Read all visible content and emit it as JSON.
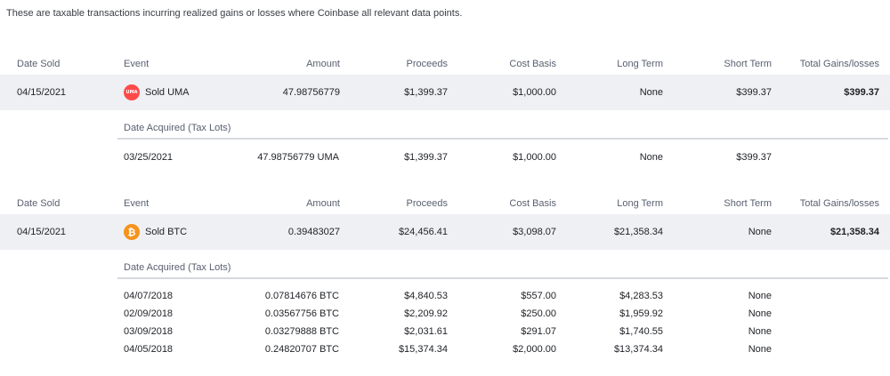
{
  "intro": "These are taxable transactions incurring realized gains or losses where Coinbase all relevant data points.",
  "headers": {
    "date_sold": "Date Sold",
    "event": "Event",
    "amount": "Amount",
    "proceeds": "Proceeds",
    "cost_basis": "Cost Basis",
    "long_term": "Long Term",
    "short_term": "Short Term",
    "total": "Total Gains/losses"
  },
  "lots_title": "Date Acquired (Tax Lots)",
  "colors": {
    "uma": "#ff4a4a",
    "btc": "#f7931a",
    "row_bg": "#eef0f3"
  },
  "transactions": [
    {
      "date_sold": "04/15/2021",
      "event": "Sold UMA",
      "icon": "uma-coin-icon",
      "icon_text": "UMA",
      "amount": "47.98756779",
      "proceeds": "$1,399.37",
      "cost_basis": "$1,000.00",
      "long_term": "None",
      "short_term": "$399.37",
      "total": "$399.37",
      "lots": [
        {
          "date": "03/25/2021",
          "amount": "47.98756779 UMA",
          "proceeds": "$1,399.37",
          "cost_basis": "$1,000.00",
          "long_term": "None",
          "short_term": "$399.37"
        }
      ]
    },
    {
      "date_sold": "04/15/2021",
      "event": "Sold BTC",
      "icon": "btc-coin-icon",
      "icon_text": "₿",
      "amount": "0.39483027",
      "proceeds": "$24,456.41",
      "cost_basis": "$3,098.07",
      "long_term": "$21,358.34",
      "short_term": "None",
      "total": "$21,358.34",
      "lots": [
        {
          "date": "04/07/2018",
          "amount": "0.07814676 BTC",
          "proceeds": "$4,840.53",
          "cost_basis": "$557.00",
          "long_term": "$4,283.53",
          "short_term": "None"
        },
        {
          "date": "02/09/2018",
          "amount": "0.03567756 BTC",
          "proceeds": "$2,209.92",
          "cost_basis": "$250.00",
          "long_term": "$1,959.92",
          "short_term": "None"
        },
        {
          "date": "03/09/2018",
          "amount": "0.03279888 BTC",
          "proceeds": "$2,031.61",
          "cost_basis": "$291.07",
          "long_term": "$1,740.55",
          "short_term": "None"
        },
        {
          "date": "04/05/2018",
          "amount": "0.24820707 BTC",
          "proceeds": "$15,374.34",
          "cost_basis": "$2,000.00",
          "long_term": "$13,374.34",
          "short_term": "None"
        }
      ]
    }
  ]
}
